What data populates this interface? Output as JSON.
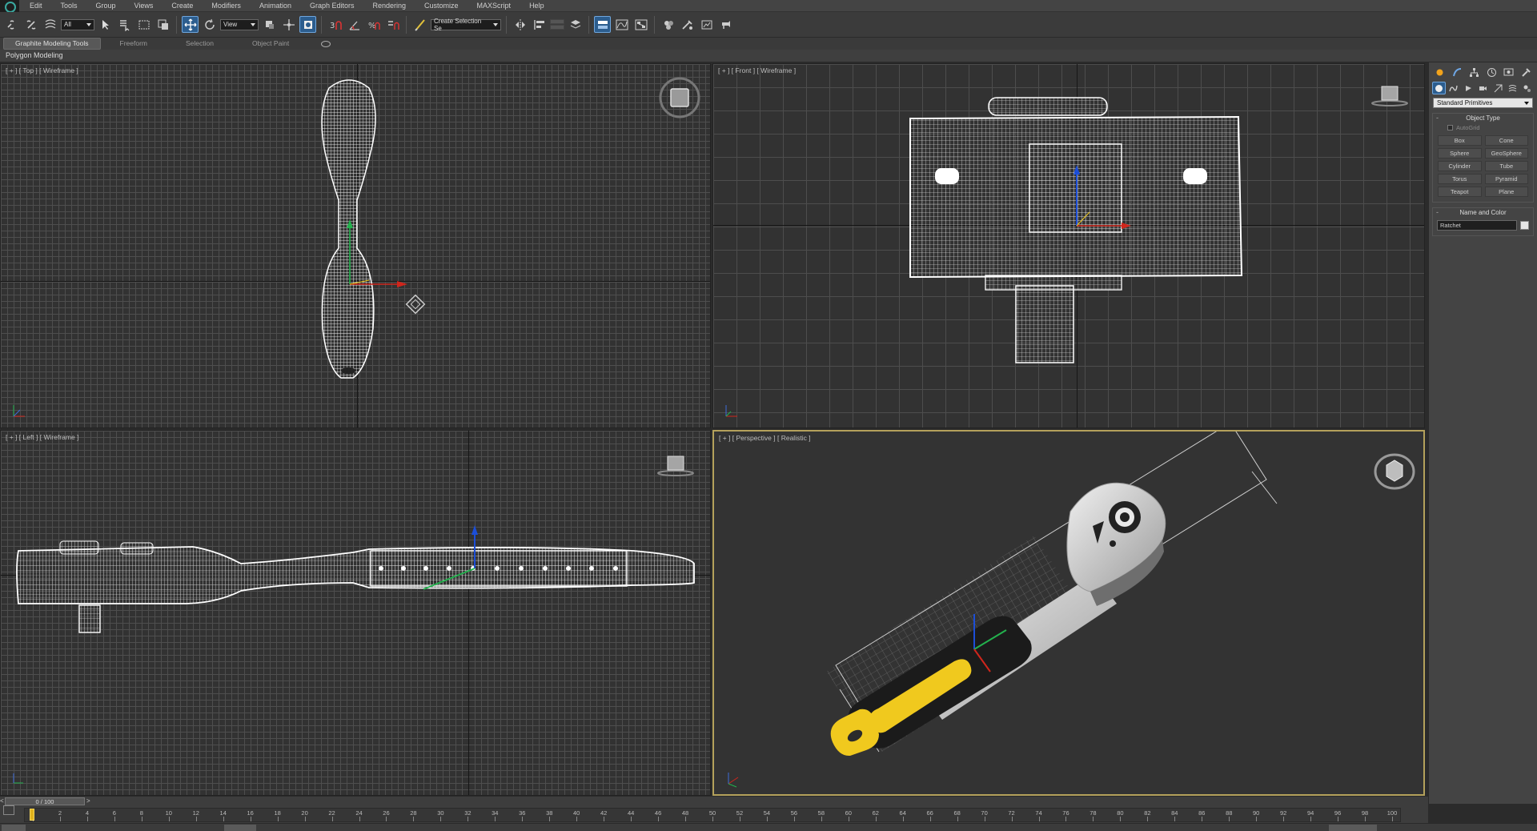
{
  "menu": [
    "Edit",
    "Tools",
    "Group",
    "Views",
    "Create",
    "Modifiers",
    "Animation",
    "Graph Editors",
    "Rendering",
    "Customize",
    "MAXScript",
    "Help"
  ],
  "toolbar": {
    "selection_filter": "All",
    "reference_coord": "View",
    "named_selection_placeholder": "Create Selection Se"
  },
  "ribbon": {
    "tabs": [
      "Graphite Modeling Tools",
      "Freeform",
      "Selection",
      "Object Paint"
    ],
    "active_tab": "Graphite Modeling Tools",
    "subpanel_label": "Polygon Modeling"
  },
  "viewports": {
    "top": {
      "label": "[ + ] [ Top ] [ Wireframe ]"
    },
    "front": {
      "label": "[ + ] [ Front ] [ Wireframe ]"
    },
    "left": {
      "label": "[ + ] [ Left ] [ Wireframe ]"
    },
    "perspective": {
      "label": "[ + ] [ Perspective ] [ Realistic ]",
      "active": true
    }
  },
  "command_panel": {
    "category_dropdown": "Standard Primitives",
    "object_type": {
      "title": "Object Type",
      "autogrid_label": "AutoGrid",
      "autogrid_checked": false,
      "buttons": [
        "Box",
        "Cone",
        "Sphere",
        "GeoSphere",
        "Cylinder",
        "Tube",
        "Torus",
        "Pyramid",
        "Teapot",
        "Plane"
      ]
    },
    "name_and_color": {
      "title": "Name and Color",
      "object_name": "Ratchet",
      "object_color": "#e6e6e6"
    }
  },
  "timeline": {
    "slider_label": "0 / 100",
    "current_frame": 0,
    "total_frames": 100,
    "ticks": [
      0,
      2,
      4,
      6,
      8,
      10,
      12,
      14,
      16,
      18,
      20,
      22,
      24,
      26,
      28,
      30,
      32,
      34,
      36,
      38,
      40,
      42,
      44,
      46,
      48,
      50,
      52,
      54,
      56,
      58,
      60,
      62,
      64,
      66,
      68,
      70,
      72,
      74,
      76,
      78,
      80,
      82,
      84,
      86,
      88,
      90,
      92,
      94,
      96,
      98,
      100
    ]
  },
  "colors": {
    "active_viewport_border": "#b4a15b",
    "active_tool": "#2c5d8e",
    "handle_accent": "#f0c91e",
    "grip_black": "#1b1b1b",
    "metal": "#c8c8c8",
    "gizmo_x": "#d0261c",
    "gizmo_y": "#23b14d",
    "gizmo_z": "#1c4ed8"
  },
  "icons": [
    "link-icon",
    "unlink-icon",
    "bind-space-warp-icon",
    "select-object-icon",
    "select-by-name-icon",
    "rectangular-selection-icon",
    "window-crossing-icon",
    "select-and-move-icon",
    "select-and-rotate-icon",
    "select-and-scale-icon",
    "pivot-icon",
    "snap-toggle-icon",
    "angle-snap-icon",
    "percent-snap-icon",
    "spinner-snap-icon",
    "edit-named-selection-icon",
    "mirror-icon",
    "align-icon",
    "layer-manager-icon",
    "graphite-toggle-icon",
    "curve-editor-icon",
    "schematic-view-icon",
    "material-editor-icon",
    "render-setup-icon",
    "rendered-frame-icon",
    "render-icon"
  ]
}
